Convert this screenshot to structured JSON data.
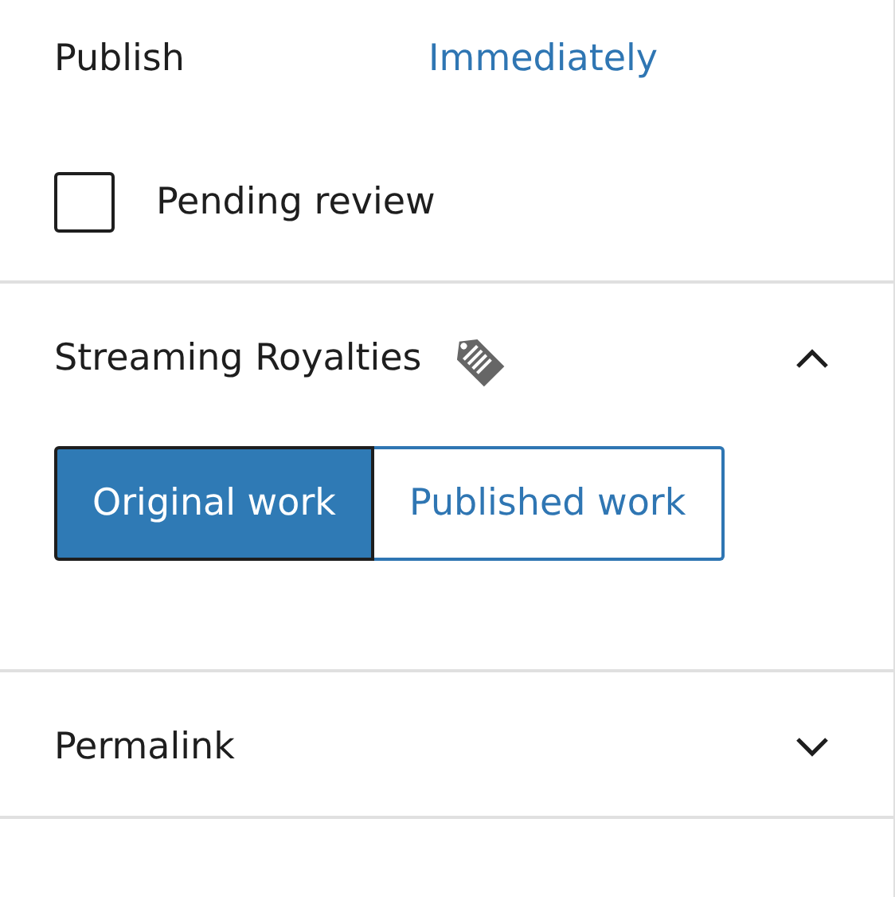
{
  "publish": {
    "label": "Publish",
    "value": "Immediately"
  },
  "pending_review": {
    "label": "Pending review",
    "checked": false
  },
  "panels": [
    {
      "title": "Streaming Royalties",
      "expanded": true,
      "has_icon": true,
      "options": [
        {
          "label": "Original work",
          "selected": true
        },
        {
          "label": "Published work",
          "selected": false
        }
      ]
    },
    {
      "title": "Permalink",
      "expanded": false,
      "has_icon": false
    }
  ]
}
